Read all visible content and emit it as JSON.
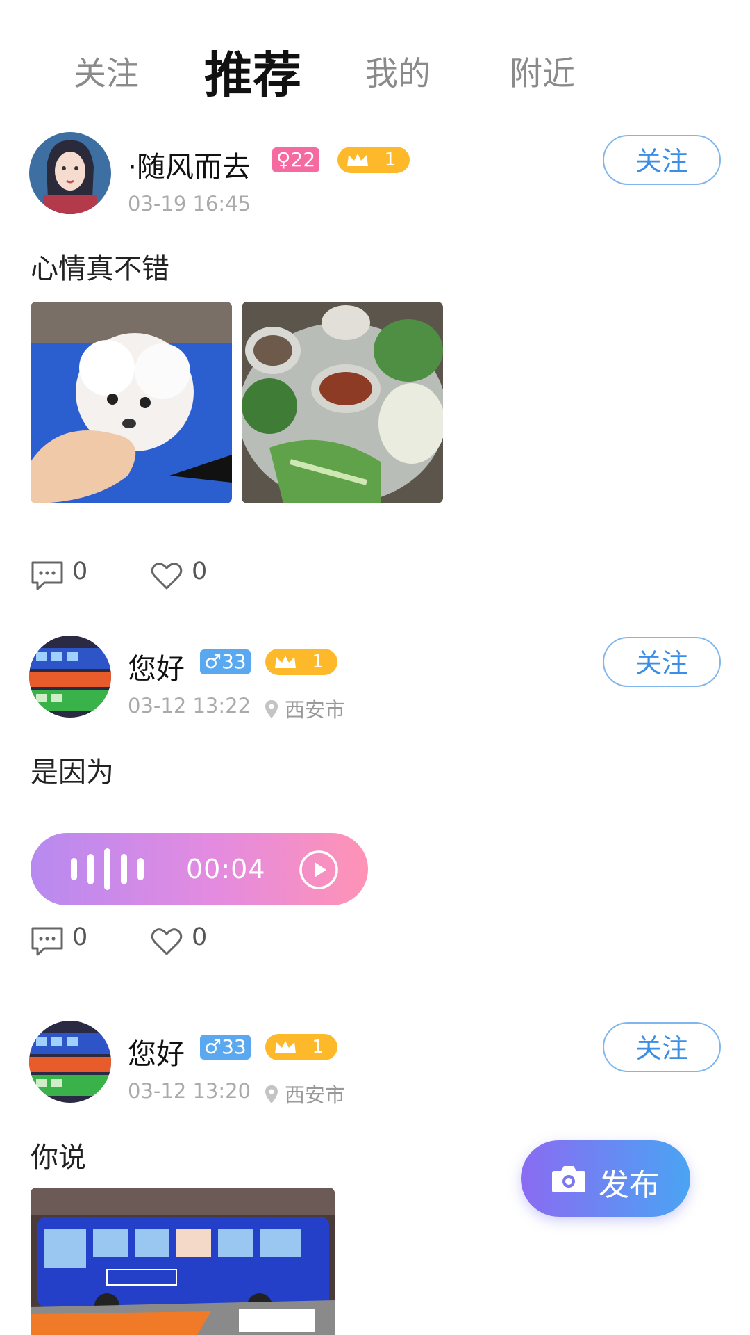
{
  "tabs": [
    {
      "label": "关注",
      "active": false
    },
    {
      "label": "推荐",
      "active": true
    },
    {
      "label": "我的",
      "active": false
    },
    {
      "label": "附近",
      "active": false
    }
  ],
  "posts": [
    {
      "username": "·随风而去",
      "gender_badge": "♀22",
      "level": "1",
      "time": "03-19 16:45",
      "location": "",
      "follow_label": "关注",
      "text": "心情真不错",
      "media": [
        "image: white fluffy puppy held in hand",
        "image: table with bowls of vegetables and food"
      ],
      "comments": "0",
      "likes": "0"
    },
    {
      "username": "您好",
      "gender_badge": "♂33",
      "level": "1",
      "time": "03-12 13:22",
      "location": "西安市",
      "follow_label": "关注",
      "text": "是因为",
      "voice_duration": "00:04",
      "comments": "0",
      "likes": "0"
    },
    {
      "username": "您好",
      "gender_badge": "♂33",
      "level": "1",
      "time": "03-12 13:20",
      "location": "西安市",
      "follow_label": "关注",
      "text": "你说",
      "media": [
        "image: blue toy city bus box"
      ]
    }
  ],
  "publish_label": "发布",
  "colors": {
    "accent": "#3a8ee6",
    "female_badge": "#f66aa2",
    "male_badge": "#5aa8ef",
    "crown_badge": "#fdb92a"
  }
}
